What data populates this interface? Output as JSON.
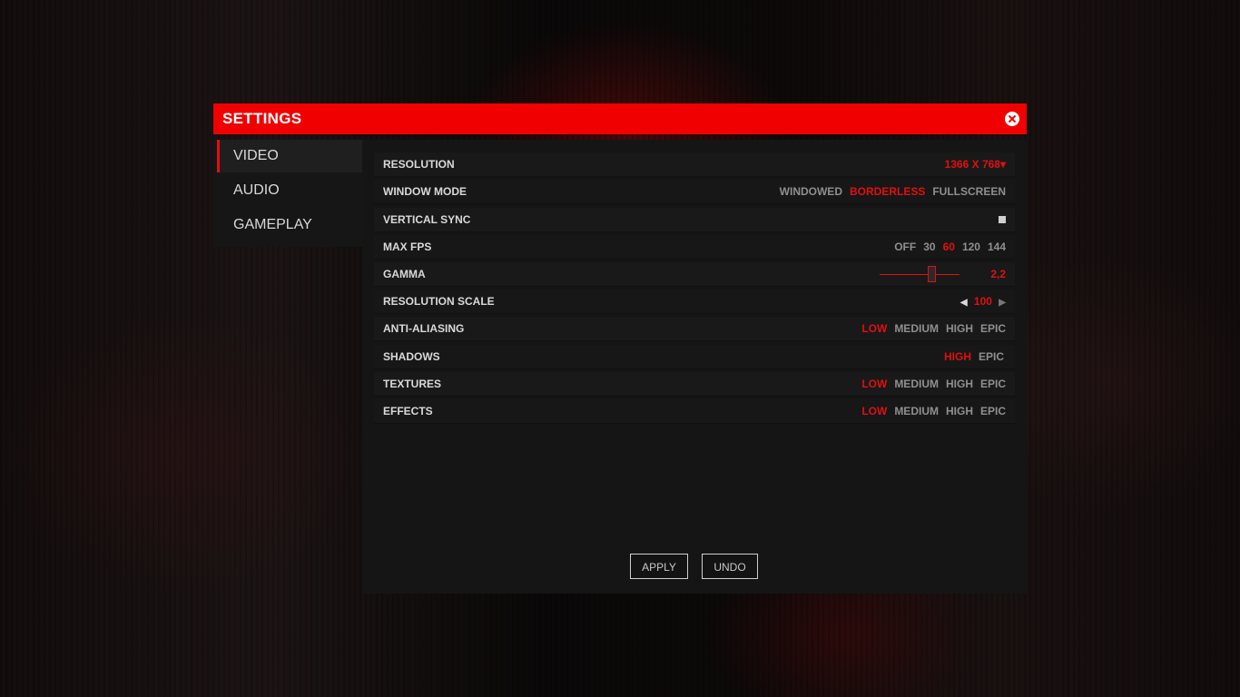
{
  "header": {
    "title": "SETTINGS"
  },
  "sidebar": {
    "items": [
      {
        "label": "VIDEO",
        "active": true
      },
      {
        "label": "AUDIO",
        "active": false
      },
      {
        "label": "GAMEPLAY",
        "active": false
      }
    ]
  },
  "settings": {
    "resolution": {
      "label": "RESOLUTION",
      "value": "1366 X 768▾"
    },
    "window_mode": {
      "label": "WINDOW MODE",
      "options": [
        "WINDOWED",
        "BORDERLESS",
        "FULLSCREEN"
      ],
      "selected": "BORDERLESS"
    },
    "vertical_sync": {
      "label": "VERTICAL SYNC",
      "checked": true
    },
    "max_fps": {
      "label": "MAX FPS",
      "options": [
        "OFF",
        "30",
        "60",
        "120",
        "144"
      ],
      "selected": "60"
    },
    "gamma": {
      "label": "GAMMA",
      "value": "2,2",
      "level_fraction": 0.65
    },
    "resolution_scale": {
      "label": "RESOLUTION SCALE",
      "value": "100",
      "left_arrow": "◀",
      "right_arrow": "▶"
    },
    "anti_aliasing": {
      "label": "ANTI-ALIASING",
      "options": [
        "LOW",
        "MEDIUM",
        "HIGH",
        "EPIC"
      ],
      "selected": "LOW"
    },
    "shadows": {
      "label": "SHADOWS",
      "options": [
        "HIGH",
        "EPIC"
      ],
      "selected": "HIGH"
    },
    "textures": {
      "label": "TEXTURES",
      "options": [
        "LOW",
        "MEDIUM",
        "HIGH",
        "EPIC"
      ],
      "selected": "LOW"
    },
    "effects": {
      "label": "EFFECTS",
      "options": [
        "LOW",
        "MEDIUM",
        "HIGH",
        "EPIC"
      ],
      "selected": "LOW"
    }
  },
  "buttons": {
    "apply": "APPLY",
    "undo": "UNDO"
  },
  "colors": {
    "accent": "#e01010",
    "header": "#f00000"
  },
  "icons": {
    "close": "close-icon",
    "dropdown": "chevron-down-icon"
  }
}
